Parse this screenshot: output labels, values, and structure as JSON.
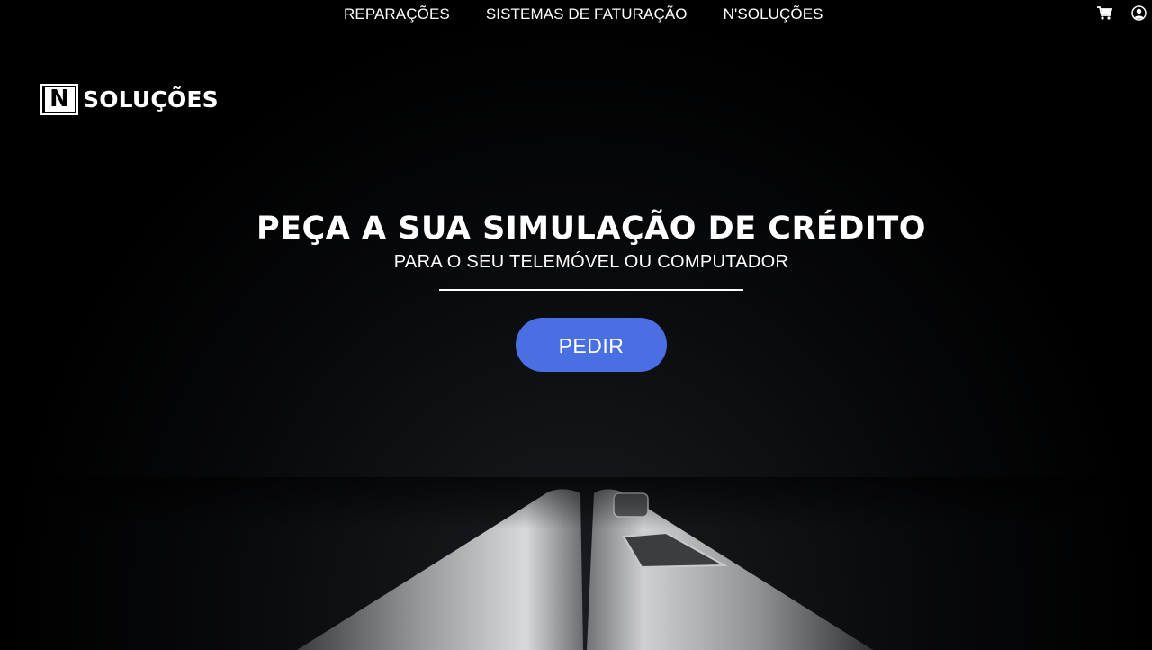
{
  "nav": {
    "links": [
      {
        "label": "REPARAÇÕES"
      },
      {
        "label": "SISTEMAS DE FATURAÇÃO"
      },
      {
        "label": "N'SOLUÇÕES"
      }
    ],
    "icons": [
      "cart-icon",
      "user-account-icon"
    ]
  },
  "logo": {
    "mark": "N",
    "text": "SOLUÇÕES"
  },
  "hero": {
    "title": "PEÇA A SUA SIMULAÇÃO DE CRÉDITO",
    "subtitle": "PARA O SEU TELEMÓVEL OU COMPUTADOR",
    "cta_label": "PEDIR"
  },
  "colors": {
    "background": "#000000",
    "accent": "#4a6fe3",
    "text": "#ffffff"
  }
}
